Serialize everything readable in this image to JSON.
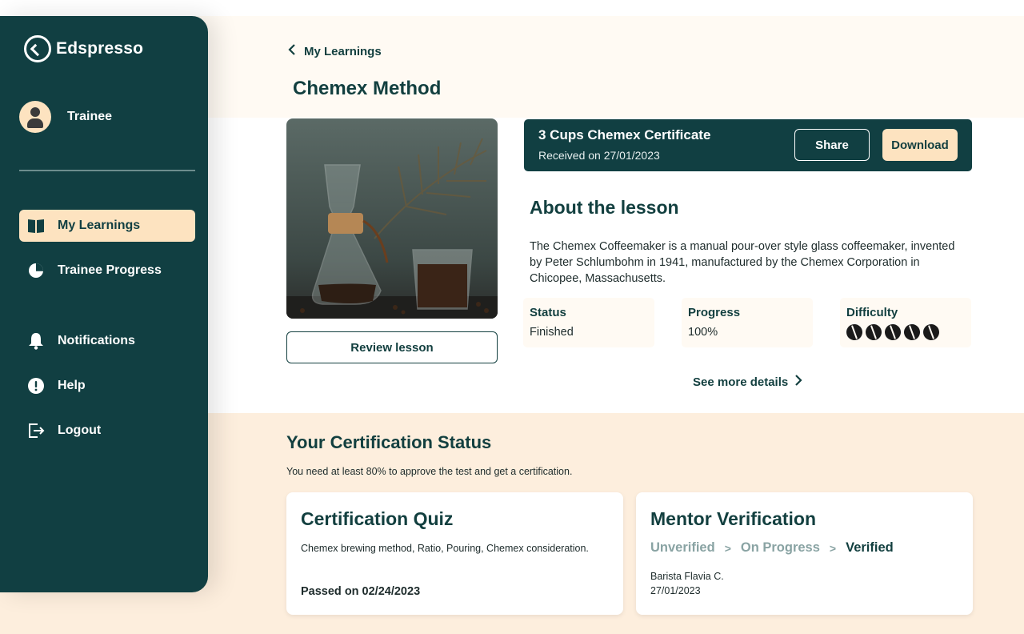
{
  "app": {
    "name": "Edspresso"
  },
  "user": {
    "role": "Trainee"
  },
  "nav": {
    "my_learnings": "My Learnings",
    "trainee_progress": "Trainee Progress",
    "notifications": "Notifications",
    "help": "Help",
    "logout": "Logout"
  },
  "header": {
    "back_label": "My Learnings",
    "title": "Chemex Method"
  },
  "lesson": {
    "review_button": "Review lesson",
    "certificate": {
      "title": "3 Cups Chemex Certificate",
      "received": "Received on 27/01/2023",
      "share_label": "Share",
      "download_label": "Download"
    },
    "about_title": "About the lesson",
    "about_text": "The Chemex Coffeemaker is a manual pour-over style glass coffeemaker, invented by Peter Schlumbohm in 1941, manufactured by the Chemex Corporation in Chicopee, Massachusetts.",
    "status": {
      "label": "Status",
      "value": "Finished"
    },
    "progress": {
      "label": "Progress",
      "value": "100%"
    },
    "difficulty": {
      "label": "Difficulty",
      "level": 5,
      "max": 5
    },
    "see_more": "See more details"
  },
  "certification": {
    "title": "Your Certification Status",
    "subtitle": "You need at least 80% to approve the test and get a certification.",
    "quiz": {
      "title": "Certification Quiz",
      "topics": "Chemex brewing method, Ratio, Pouring, Chemex consideration.",
      "passed": "Passed on 02/24/2023"
    },
    "mentor": {
      "title": "Mentor Verification",
      "steps": [
        "Unverified",
        "On Progress",
        "Verified"
      ],
      "name": "Barista Flavia C.",
      "date": "27/01/2023"
    }
  },
  "colors": {
    "primary": "#113f42",
    "accent": "#fde3c0",
    "cream": "#fffaf3",
    "peach": "#fdeedd"
  }
}
